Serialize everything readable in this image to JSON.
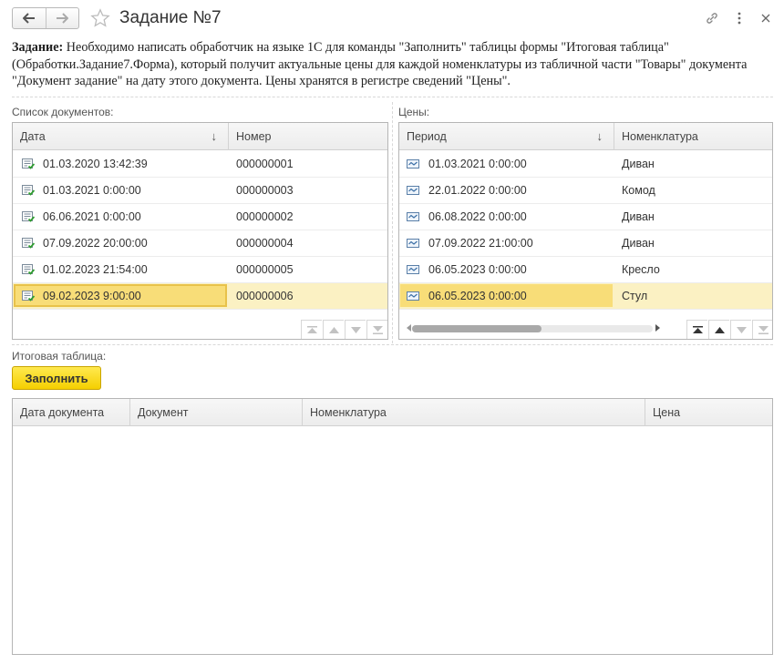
{
  "window": {
    "title": "Задание №7"
  },
  "task": {
    "label": "Задание:",
    "text": " Необходимо написать обработчик на языке 1С для команды \"Заполнить\" таблицы формы \"Итоговая таблица\" (Обработки.Задание7.Форма), который получит актуальные цены для каждой номенклатуры из табличной части \"Товары\" документа \"Документ задание\" на дату этого документа. Цены хранятся в регистре сведений \"Цены\"."
  },
  "documents": {
    "group_label": "Список документов:",
    "columns": [
      "Дата",
      "Номер"
    ],
    "rows": [
      {
        "date": "01.03.2020 13:42:39",
        "number": "000000001"
      },
      {
        "date": "01.03.2021 0:00:00",
        "number": "000000003"
      },
      {
        "date": "06.06.2021 0:00:00",
        "number": "000000002"
      },
      {
        "date": "07.09.2022 20:00:00",
        "number": "000000004"
      },
      {
        "date": "01.02.2023 21:54:00",
        "number": "000000005"
      },
      {
        "date": "09.02.2023 9:00:00",
        "number": "000000006"
      }
    ],
    "selected_index": 5
  },
  "prices": {
    "group_label": "Цены:",
    "columns": [
      "Период",
      "Номенклатура"
    ],
    "rows": [
      {
        "period": "01.03.2021 0:00:00",
        "item": "Диван"
      },
      {
        "period": "22.01.2022 0:00:00",
        "item": "Комод"
      },
      {
        "period": "06.08.2022 0:00:00",
        "item": "Диван"
      },
      {
        "period": "07.09.2022 21:00:00",
        "item": "Диван"
      },
      {
        "period": "06.05.2023 0:00:00",
        "item": "Кресло"
      },
      {
        "period": "06.05.2023 0:00:00",
        "item": "Стул"
      }
    ],
    "selected_index": 5
  },
  "result": {
    "group_label": "Итоговая таблица:",
    "fill_button": "Заполнить",
    "columns": [
      "Дата документа",
      "Документ",
      "Номенклатура",
      "Цена"
    ]
  },
  "colors": {
    "accent_yellow": "#f5cf00",
    "selection": "#fbf1c3"
  }
}
